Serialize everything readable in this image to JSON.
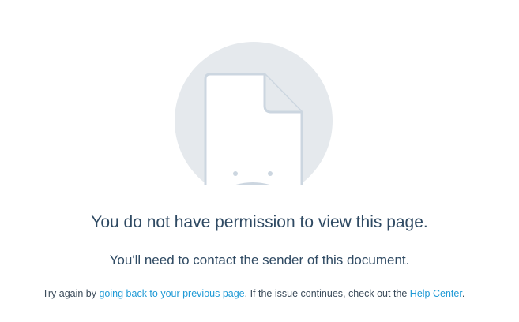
{
  "illustration": {
    "icon": "sad-document-icon",
    "circle_color": "#e5e9ed",
    "stroke_color": "#ccd6e0"
  },
  "message": {
    "heading": "You do not have permission to view this page.",
    "subheading": "You'll need to contact the sender of this document.",
    "help": {
      "prefix": "Try again by ",
      "back_link": "going back to your previous page",
      "middle": ". If the issue continues, check out the ",
      "help_link": "Help Center",
      "suffix": "."
    }
  },
  "colors": {
    "text": "#2f4a63",
    "link": "#1f9ad6"
  }
}
